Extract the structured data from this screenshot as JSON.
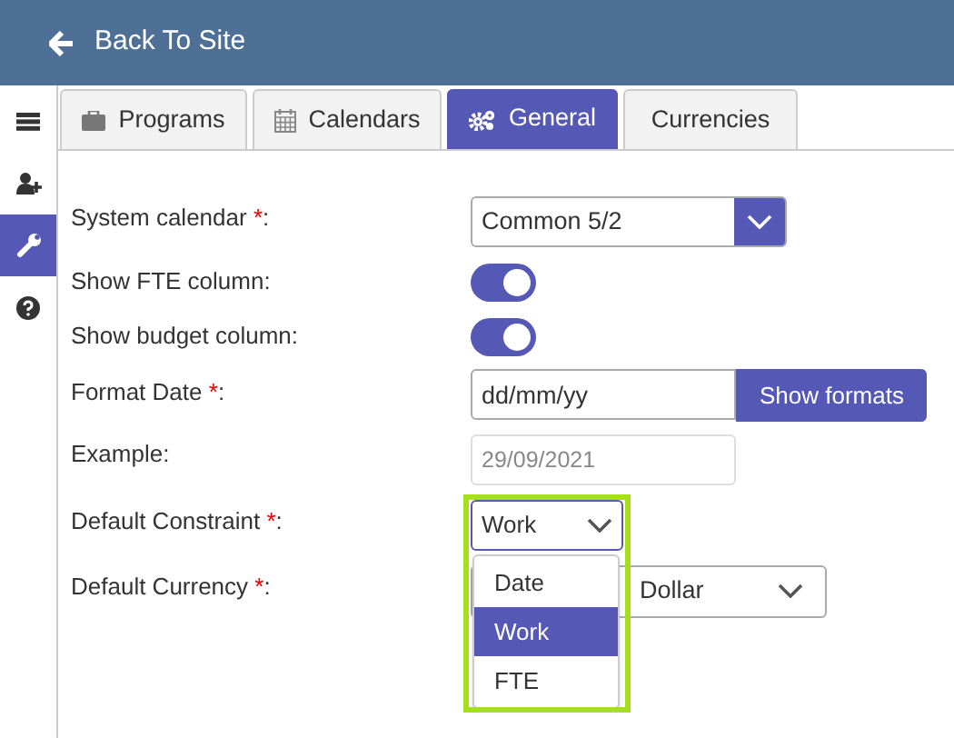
{
  "header": {
    "back_label": "Back To Site"
  },
  "sidebar": {
    "items": [
      {
        "selected": false
      },
      {
        "selected": false
      },
      {
        "selected": true
      },
      {
        "selected": false
      }
    ]
  },
  "tabs": [
    {
      "label": "Programs",
      "selected": false
    },
    {
      "label": "Calendars",
      "selected": false
    },
    {
      "label": "General",
      "selected": true
    },
    {
      "label": "Currencies",
      "selected": false
    }
  ],
  "form": [
    {
      "kind": "select",
      "label": "System calendar",
      "required_mark": "*",
      "label_end": ":",
      "value": "Common 5/2"
    },
    {
      "kind": "toggle",
      "label": "Show FTE column:",
      "on": true
    },
    {
      "kind": "toggle",
      "label": "Show budget column:",
      "on": true
    },
    {
      "kind": "input",
      "label": "Format Date",
      "required_mark": "*",
      "label_end": ":",
      "value": "dd/mm/yy",
      "button": "Show formats"
    },
    {
      "kind": "readonly",
      "label": "Example:",
      "value": "29/09/2021"
    },
    {
      "kind": "dropdown",
      "label": "Default Constraint",
      "required_mark": "*",
      "label_end": ":",
      "value": "Work",
      "options": [
        {
          "label": "Date",
          "selected": false
        },
        {
          "label": "Work",
          "selected": true
        },
        {
          "label": "FTE",
          "selected": false
        }
      ]
    },
    {
      "kind": "plain-select",
      "label": "Default Currency",
      "required_mark": "*",
      "label_end": ":",
      "value": "Dollar"
    }
  ]
}
